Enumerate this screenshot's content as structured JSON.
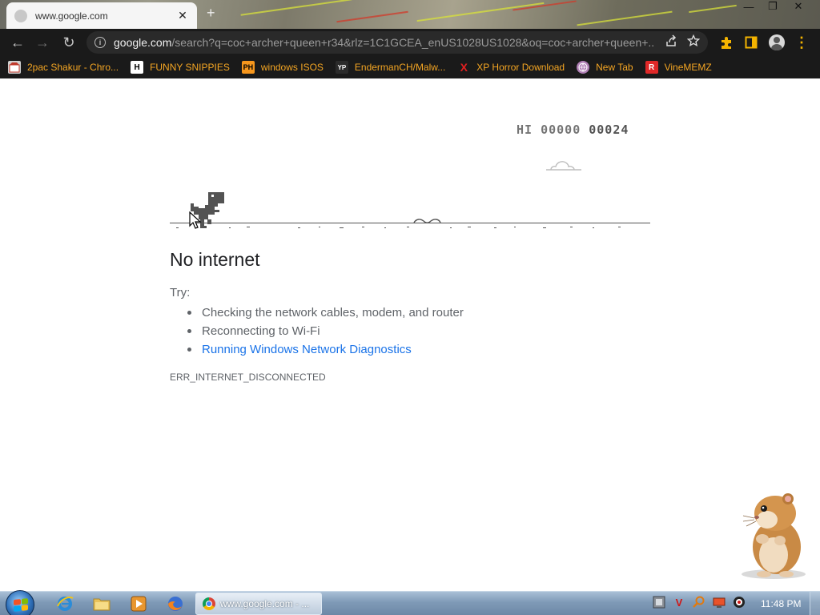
{
  "browser": {
    "tab": {
      "title": "www.google.com",
      "close": "✕"
    },
    "new_tab": "+",
    "window_controls": {
      "minimize": "—",
      "restore": "❐",
      "close": "✕"
    },
    "nav": {
      "back": "←",
      "forward": "→",
      "reload": "↻"
    },
    "address": {
      "host": "google.com",
      "path": "/search?q=coc+archer+queen+r34&rlz=1C1GCEA_enUS1028US1028&oq=coc+archer+queen+..."
    },
    "bookmarks": [
      {
        "label": "2pac Shakur - Chro...",
        "icon": "page-icon",
        "icon_text": "",
        "icon_bg": "#d0d0d0",
        "icon_color": "#c0392b"
      },
      {
        "label": "FUNNY SNIPPIES",
        "icon": "h-logo-icon",
        "icon_text": "H",
        "icon_bg": "#ffffff",
        "icon_color": "#000000"
      },
      {
        "label": "windows ISOS",
        "icon": "ph-logo-icon",
        "icon_text": "PH",
        "icon_bg": "#f7971d",
        "icon_color": "#000000"
      },
      {
        "label": "EndermanCH/Malw...",
        "icon": "yp-logo-icon",
        "icon_text": "YP",
        "icon_bg": "#2b2b2b",
        "icon_color": "#ffffff"
      },
      {
        "label": "XP Horror Download",
        "icon": "x-logo-icon",
        "icon_text": "X",
        "icon_bg": "transparent",
        "icon_color": "#e02020"
      },
      {
        "label": "New Tab",
        "icon": "globe-icon",
        "icon_text": "",
        "icon_bg": "#b07fb5",
        "icon_color": "#ffffff"
      },
      {
        "label": "VineMEMZ",
        "icon": "r-logo-icon",
        "icon_text": "R",
        "icon_bg": "#e02828",
        "icon_color": "#ffffff"
      }
    ]
  },
  "game": {
    "hi_label": "HI",
    "hi_score": "00000",
    "score": "00024"
  },
  "error": {
    "title": "No internet",
    "try": "Try:",
    "suggestions": [
      "Checking the network cables, modem, and router",
      "Reconnecting to Wi-Fi",
      "Running Windows Network Diagnostics"
    ],
    "code": "ERR_INTERNET_DISCONNECTED"
  },
  "taskbar": {
    "pinned": [
      "ie-icon",
      "folder-icon",
      "media-player-icon",
      "firefox-icon"
    ],
    "task_label": "www.google.com - ...",
    "clock": "11:48 PM"
  },
  "colors": {
    "link": "#1a73e8",
    "bookmark_text": "#f5a623",
    "toolbar_bg": "#1a1a1a"
  }
}
